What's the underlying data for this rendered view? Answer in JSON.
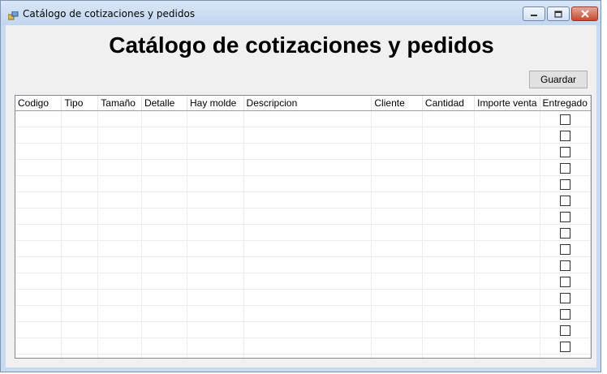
{
  "window": {
    "title": "Catálogo de cotizaciones y pedidos"
  },
  "header": {
    "title": "Catálogo de cotizaciones y pedidos"
  },
  "toolbar": {
    "save_label": "Guardar"
  },
  "table": {
    "columns": [
      "Codigo",
      "Tipo",
      "Tamaño",
      "Detalle",
      "Hay molde",
      "Descripcion",
      "Cliente",
      "Cantidad",
      "Importe venta",
      "Entregado"
    ],
    "row_count": 16,
    "entregado_checked": [
      false,
      false,
      false,
      false,
      false,
      false,
      false,
      false,
      false,
      false,
      false,
      false,
      false,
      false,
      false,
      false
    ]
  }
}
